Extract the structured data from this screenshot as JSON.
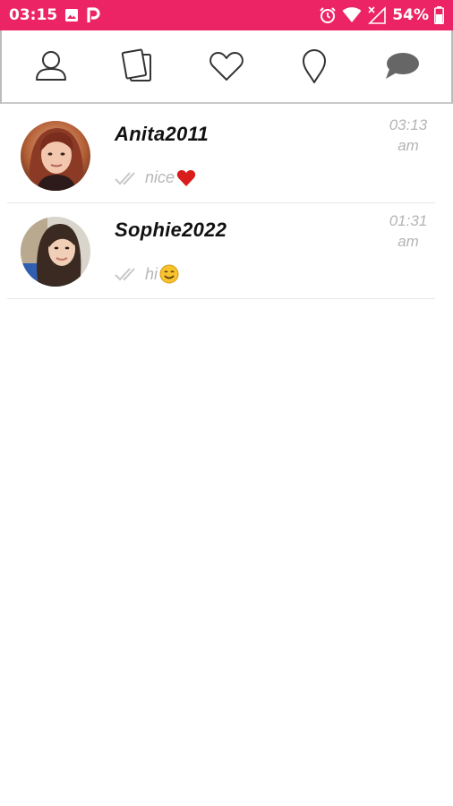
{
  "status_bar": {
    "time": "03:15",
    "battery_percent": "54%",
    "icons": [
      "image-icon",
      "p-app-icon",
      "alarm-icon",
      "wifi-icon",
      "no-signal-icon",
      "battery-icon"
    ]
  },
  "tabs": [
    {
      "name": "profile",
      "icon": "user-icon"
    },
    {
      "name": "cards",
      "icon": "cards-icon"
    },
    {
      "name": "likes",
      "icon": "heart-icon"
    },
    {
      "name": "nearby",
      "icon": "location-pin-icon"
    },
    {
      "name": "messages",
      "icon": "chat-bubble-icon",
      "active": true
    }
  ],
  "conversations": [
    {
      "username": "Anita2011",
      "last_message": "nice",
      "emoji": "red-heart",
      "time_line1": "03:13",
      "time_line2": "am",
      "status": "read"
    },
    {
      "username": "Sophie2022",
      "last_message": "hi",
      "emoji": "smiling-face",
      "time_line1": "01:31",
      "time_line2": "am",
      "status": "read"
    }
  ],
  "colors": {
    "accent": "#ec2466",
    "muted_text": "#b7b7b7",
    "active_tab_icon": "#666666",
    "tab_icon": "#333333"
  }
}
